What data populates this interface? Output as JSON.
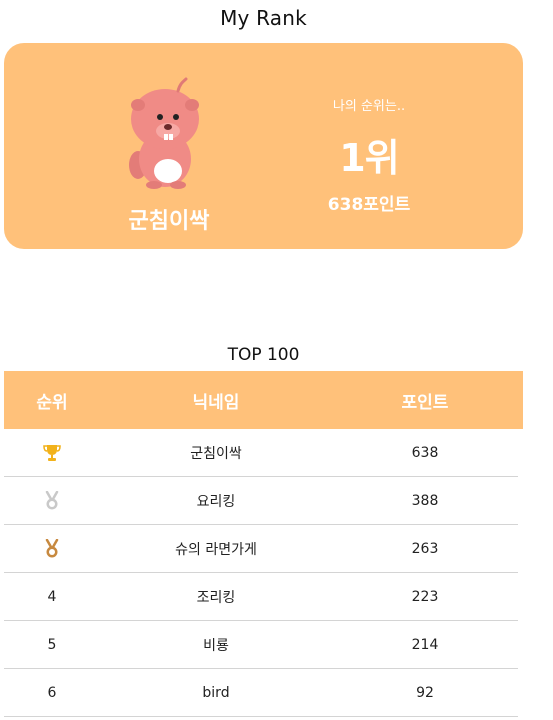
{
  "page": {
    "title": "My Rank"
  },
  "my_rank": {
    "nickname": "군침이싹",
    "rank_label": "나의 순위는..",
    "rank_value": "1위",
    "points": "638포인트"
  },
  "leaderboard": {
    "title": "TOP 100",
    "headers": {
      "rank": "순위",
      "nickname": "닉네임",
      "points": "포인트"
    },
    "rows": [
      {
        "rank": "",
        "icon": "gold-trophy-icon",
        "nickname": "군침이싹",
        "points": "638"
      },
      {
        "rank": "",
        "icon": "silver-medal-icon",
        "nickname": "요리킹",
        "points": "388"
      },
      {
        "rank": "",
        "icon": "bronze-medal-icon",
        "nickname": "슈의 라면가게",
        "points": "263"
      },
      {
        "rank": "4",
        "nickname": "조리킹",
        "points": "223"
      },
      {
        "rank": "5",
        "nickname": "비룡",
        "points": "214"
      },
      {
        "rank": "6",
        "nickname": "bird",
        "points": "92"
      }
    ]
  },
  "colors": {
    "accent": "#ffc17a",
    "gold": "#f2b21b",
    "silver": "#c9c9c9",
    "bronze": "#c7893f",
    "avatar": "#f08b86"
  }
}
